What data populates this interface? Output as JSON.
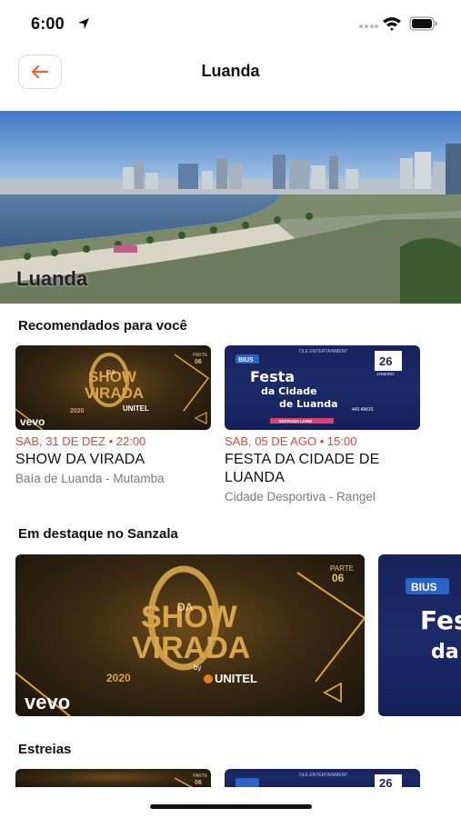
{
  "status": {
    "time": "6:00"
  },
  "nav": {
    "title": "Luanda"
  },
  "hero": {
    "title": "Luanda"
  },
  "sections": {
    "recommended": "Recomendados para você",
    "featured": "Em destaque no Sanzala",
    "premieres": "Estreias"
  },
  "recommended": [
    {
      "date": "SAB, 31 DE DEZ • 22:00",
      "title": "SHOW DA VIRADA",
      "place": "Baía de Luanda - Mutamba"
    },
    {
      "date": "SAB, 05 DE AGO • 15:00",
      "title": "FESTA DA CIDADE DE LUANDA",
      "place": "Cidade Desportiva - Rangel"
    }
  ],
  "show_art": {
    "line1": "SHOW",
    "da": "DA",
    "line2": "VIRADA",
    "year": "2020",
    "by": "by",
    "brand": "UNITEL",
    "vevo": "vevo",
    "parte": "PARTE",
    "parte_num": "06"
  },
  "festa_art": {
    "tag": "OLE ENTERTAINMENT",
    "badge": "BIUS",
    "line1": "Festa",
    "line2": "da Cidade",
    "line3": "de Luanda",
    "anos": "443 ANOS",
    "day": "26",
    "month": "JANEIRO",
    "entry": "ENTRADA LIVRE"
  },
  "colors": {
    "accent": "#e0443a",
    "back_arrow": "#e8652a"
  }
}
